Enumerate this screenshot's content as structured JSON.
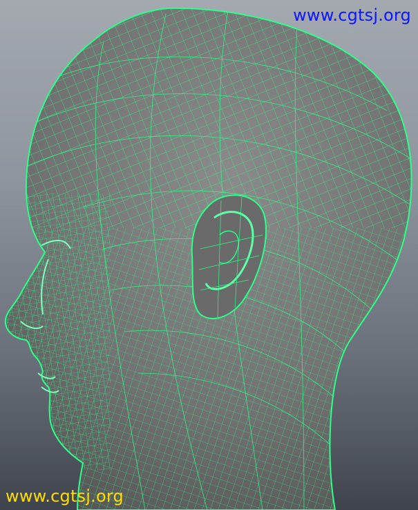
{
  "viewport": {
    "background_top": "#a4a9b0",
    "background_bottom": "#3f444c"
  },
  "model": {
    "subject": "head-profile-wireframe",
    "surface_color": "#7c7c7c",
    "surface_shade": "#5a5a5a",
    "wire_color": "#2dff8a",
    "wire_highlight": "#7dffbf"
  },
  "watermarks": {
    "top": {
      "text": "www.cgtsj.org",
      "color": "#0c16ff"
    },
    "bottom": {
      "text": "www.cgtsj.org",
      "color": "#ffdd00"
    }
  }
}
